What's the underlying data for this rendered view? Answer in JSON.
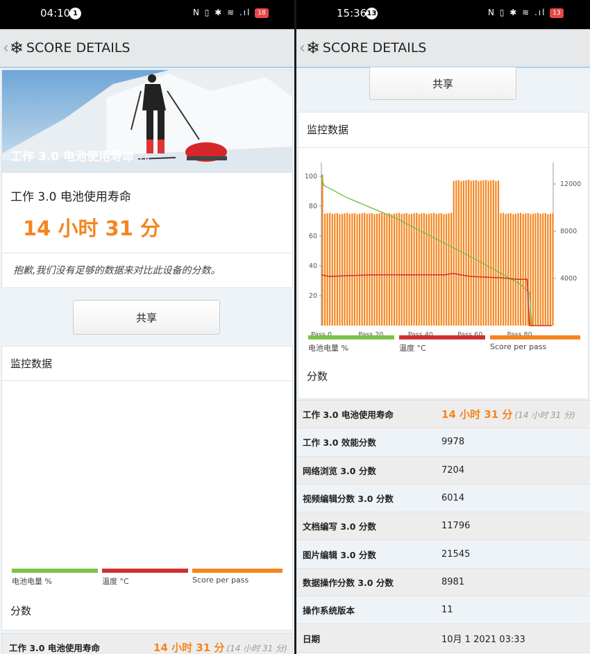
{
  "left": {
    "status": {
      "time": "04:10",
      "badge": "1",
      "icons": "N ▯ ✱ ≋ .ıl",
      "battery": "18"
    },
    "appbar": {
      "title": "SCORE DETAILS"
    },
    "hero": {
      "label": "工作 3.0 电池使用寿命",
      "version": "3.0"
    },
    "result": {
      "title": "工作 3.0 电池使用寿命",
      "score": "14 小时 31 分"
    },
    "sorry_text": "抱歉,我们没有足够的数据来对比此设备的分数。",
    "share_label": "共享",
    "monitor_title": "监控数据",
    "scores_title": "分数",
    "first_row": {
      "name": "工作 3.0 电池使用寿命",
      "value": "14 小时 31 分",
      "paren": "(14 小时 31 分)"
    }
  },
  "right": {
    "status": {
      "time": "15:36",
      "badge": "13",
      "icons": "N ▯ ✱ ≋ .ıl",
      "battery": "13"
    },
    "appbar": {
      "title": "SCORE DETAILS"
    },
    "share_label": "共享",
    "monitor_title": "监控数据",
    "scores_title": "分数",
    "score_rows": [
      {
        "name": "工作 3.0 电池使用寿命",
        "value": "14 小时 31 分",
        "paren": "(14 小时 31 分)"
      },
      {
        "name": "工作 3.0 效能分数",
        "value": "9978"
      },
      {
        "name": "网络浏览 3.0 分数",
        "value": "7204"
      },
      {
        "name": "视频编辑分数 3.0 分数",
        "value": "6014"
      },
      {
        "name": "文档编写 3.0 分数",
        "value": "11796"
      },
      {
        "name": "图片编辑 3.0 分数",
        "value": "21545"
      },
      {
        "name": "数据操作分数 3.0 分数",
        "value": "8981"
      },
      {
        "name": "操作系统版本",
        "value": "11"
      },
      {
        "name": "日期",
        "value": "10月 1 2021 03:33"
      }
    ]
  },
  "colors": {
    "accent": "#f5851f",
    "battery_line": "#7cc24a",
    "temp_line": "#d0312d",
    "bars": "#f5851f"
  },
  "chart_data": {
    "type": "bar",
    "x_tick_labels": [
      "Pass 0",
      "Pass 20",
      "Pass 40",
      "Pass 60",
      "Pass 80"
    ],
    "x_range": [
      0,
      93
    ],
    "left_axis": {
      "ticks": [
        20,
        40,
        60,
        80,
        100
      ],
      "range": [
        0,
        100
      ]
    },
    "right_axis": {
      "ticks": [
        4000,
        8000,
        12000
      ],
      "range": [
        0,
        13000
      ]
    },
    "series": [
      {
        "name": "电池电量 %",
        "type": "line",
        "axis": "left",
        "points": [
          [
            0,
            100
          ],
          [
            1,
            94
          ],
          [
            10,
            86
          ],
          [
            30,
            72
          ],
          [
            50,
            55
          ],
          [
            65,
            42
          ],
          [
            80,
            28
          ],
          [
            84,
            22
          ],
          [
            85,
            0
          ]
        ]
      },
      {
        "name": "温度 °C",
        "type": "line",
        "axis": "left",
        "points": [
          [
            0,
            34
          ],
          [
            3,
            33
          ],
          [
            20,
            34
          ],
          [
            50,
            34
          ],
          [
            53,
            35
          ],
          [
            60,
            33
          ],
          [
            73,
            32
          ],
          [
            79,
            31
          ],
          [
            83,
            31
          ],
          [
            84,
            0
          ],
          [
            93,
            0
          ]
        ]
      },
      {
        "name": "Score per pass",
        "type": "bar",
        "axis": "right",
        "segments": [
          {
            "from": 0,
            "to": 0,
            "value": 12800
          },
          {
            "from": 1,
            "to": 52,
            "value": 9500
          },
          {
            "from": 53,
            "to": 71,
            "value": 12300
          },
          {
            "from": 72,
            "to": 93,
            "value": 9500
          }
        ]
      }
    ]
  }
}
